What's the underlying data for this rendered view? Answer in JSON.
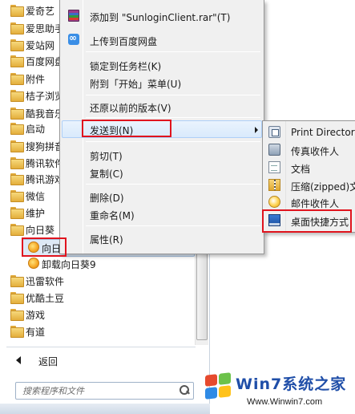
{
  "programs": {
    "items": [
      {
        "label": "爱奇艺",
        "type": "folder"
      },
      {
        "label": "爱思助手",
        "type": "folder"
      },
      {
        "label": "爱站网",
        "type": "folder"
      },
      {
        "label": "百度网盘",
        "type": "folder"
      },
      {
        "label": "附件",
        "type": "folder"
      },
      {
        "label": "桔子浏览",
        "type": "folder"
      },
      {
        "label": "酷我音乐",
        "type": "folder"
      },
      {
        "label": "启动",
        "type": "folder"
      },
      {
        "label": "搜狗拼音",
        "type": "folder"
      },
      {
        "label": "腾讯软件",
        "type": "folder"
      },
      {
        "label": "腾讯游戏",
        "type": "folder"
      },
      {
        "label": "微信",
        "type": "folder"
      },
      {
        "label": "维护",
        "type": "folder"
      },
      {
        "label": "向日葵",
        "type": "folder"
      },
      {
        "label": "向日",
        "type": "app"
      },
      {
        "label": "卸载向日葵9",
        "type": "app"
      },
      {
        "label": "迅雷软件",
        "type": "folder"
      },
      {
        "label": "优酷土豆",
        "type": "folder"
      },
      {
        "label": "游戏",
        "type": "folder"
      },
      {
        "label": "有道",
        "type": "folder"
      }
    ],
    "back_label": "返回",
    "search_placeholder": "搜索程序和文件"
  },
  "context_menu": {
    "items": [
      {
        "label": "添加到 \"SunloginClient.rar\"(T)",
        "icon": "winrar-icon"
      },
      {
        "label": "上传到百度网盘",
        "icon": "baidu-cloud-icon"
      },
      {
        "label": "锁定到任务栏(K)"
      },
      {
        "label": "附到「开始」菜单(U)"
      },
      {
        "label": "还原以前的版本(V)"
      },
      {
        "label": "发送到(N)",
        "has_submenu": true,
        "highlighted": true
      },
      {
        "label": "剪切(T)"
      },
      {
        "label": "复制(C)"
      },
      {
        "label": "删除(D)"
      },
      {
        "label": "重命名(M)"
      },
      {
        "label": "属性(R)"
      }
    ]
  },
  "send_to_menu": {
    "items": [
      {
        "label": "Print Directory",
        "icon": "printer-icon"
      },
      {
        "label": "传真收件人",
        "icon": "fax-icon"
      },
      {
        "label": "文档",
        "icon": "document-icon"
      },
      {
        "label": "压缩(zipped)文",
        "icon": "zip-folder-icon"
      },
      {
        "label": "邮件收件人",
        "icon": "mail-icon"
      },
      {
        "label": "桌面快捷方式",
        "icon": "desktop-icon",
        "highlighted": true
      }
    ]
  },
  "annotations": {
    "highlight_color": "#e0141e"
  },
  "watermark": {
    "title": "Win7系统之家",
    "url": "Www.Winwin7.com"
  }
}
